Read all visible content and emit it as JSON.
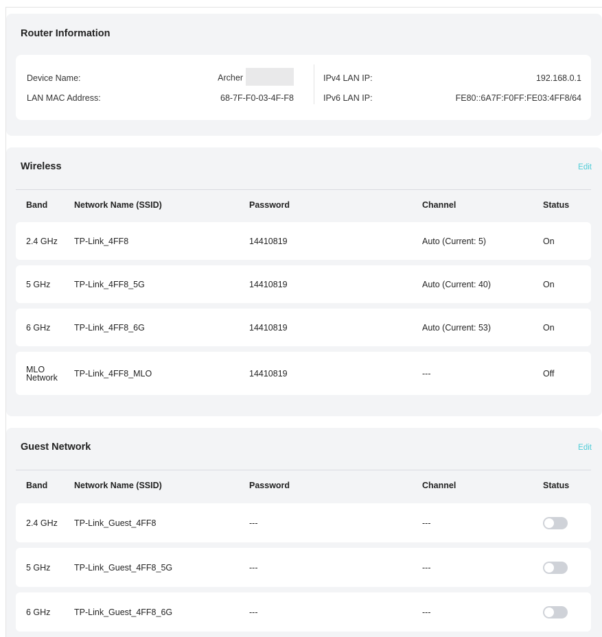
{
  "router_info": {
    "title": "Router Information",
    "device_name_label": "Device Name:",
    "device_name_value": "Archer",
    "lan_mac_label": "LAN MAC Address:",
    "lan_mac_value": "68-7F-F0-03-4F-F8",
    "ipv4_label": "IPv4 LAN IP:",
    "ipv4_value": "192.168.0.1",
    "ipv6_label": "IPv6 LAN IP:",
    "ipv6_value": "FE80::6A7F:F0FF:FE03:4FF8/64"
  },
  "wireless": {
    "title": "Wireless",
    "edit_label": "Edit",
    "columns": [
      "Band",
      "Network Name (SSID)",
      "Password",
      "Channel",
      "Status"
    ],
    "rows": [
      {
        "band": "2.4 GHz",
        "ssid": "TP-Link_4FF8",
        "password": "14410819",
        "channel": "Auto (Current: 5)",
        "status": "On"
      },
      {
        "band": "5 GHz",
        "ssid": "TP-Link_4FF8_5G",
        "password": "14410819",
        "channel": "Auto (Current: 40)",
        "status": "On"
      },
      {
        "band": "6 GHz",
        "ssid": "TP-Link_4FF8_6G",
        "password": "14410819",
        "channel": "Auto (Current: 53)",
        "status": "On"
      },
      {
        "band_line1": "MLO",
        "band_line2": "Network",
        "ssid": "TP-Link_4FF8_MLO",
        "password": "14410819",
        "channel": "---",
        "status": "Off"
      }
    ]
  },
  "guest": {
    "title": "Guest Network",
    "edit_label": "Edit",
    "columns": [
      "Band",
      "Network Name (SSID)",
      "Password",
      "Channel",
      "Status"
    ],
    "rows": [
      {
        "band": "2.4 GHz",
        "ssid": "TP-Link_Guest_4FF8",
        "password": "---",
        "channel": "---",
        "enabled": false
      },
      {
        "band": "5 GHz",
        "ssid": "TP-Link_Guest_4FF8_5G",
        "password": "---",
        "channel": "---",
        "enabled": false
      },
      {
        "band": "6 GHz",
        "ssid": "TP-Link_Guest_4FF8_6G",
        "password": "---",
        "channel": "---",
        "enabled": false
      }
    ]
  },
  "colors": {
    "accent": "#4acbd6",
    "card_bg": "#f3f4f6",
    "toggle_off": "#cfd2d8"
  }
}
